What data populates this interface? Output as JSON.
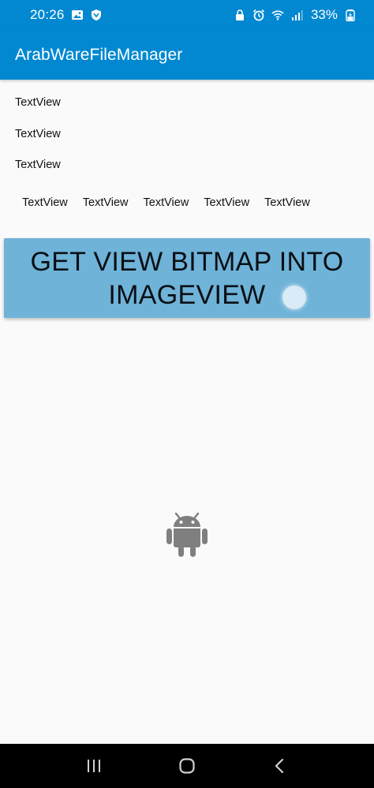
{
  "status_bar": {
    "time": "20:26",
    "battery": "33%",
    "icons_left": [
      "image-icon",
      "shield-app-icon"
    ],
    "icons_right": [
      "lock-icon",
      "alarm-icon",
      "wifi-icon",
      "signal-icon",
      "battery-icon"
    ]
  },
  "app_bar": {
    "title": "ArabWareFileManager",
    "color": "#0288d1"
  },
  "text_views": {
    "first": "TextView",
    "second": "TextView",
    "third": "TextView",
    "row": [
      "TextView",
      "TextView",
      "TextView",
      "TextView",
      "TextView"
    ]
  },
  "bitmap_button": {
    "label": "GET VIEW BITMAP INTO IMAGEVIEW",
    "color": "#6fb3d8"
  },
  "image_view": {
    "icon": "android-icon"
  },
  "nav_bar": {
    "buttons": [
      "recent-apps-icon",
      "home-icon",
      "back-icon"
    ]
  }
}
